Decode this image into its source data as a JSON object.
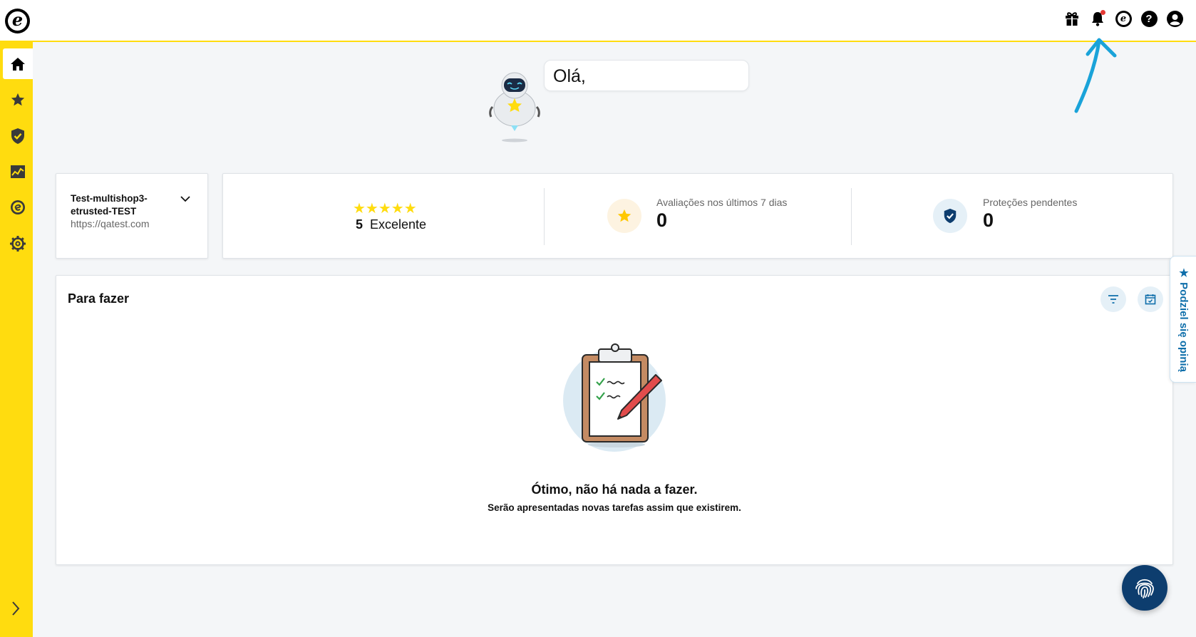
{
  "header": {
    "logo_letter": "e",
    "icons": [
      "gift-icon",
      "bell-icon",
      "trustedshops-icon",
      "help-icon",
      "account-icon"
    ],
    "trusted_letter": "e",
    "help_symbol": "?"
  },
  "sidebar": {
    "items": [
      {
        "name": "home",
        "icon": "home-icon",
        "active": true
      },
      {
        "name": "reviews",
        "icon": "star-icon",
        "active": false
      },
      {
        "name": "protection",
        "icon": "shield-icon",
        "active": false
      },
      {
        "name": "analytics",
        "icon": "chart-icon",
        "active": false
      },
      {
        "name": "etrusted",
        "icon": "e-logo-icon",
        "active": false
      },
      {
        "name": "settings",
        "icon": "gear-icon",
        "active": false
      }
    ],
    "expand_icon": "chevron-right-icon"
  },
  "greeting": {
    "text": "Olá,"
  },
  "shop": {
    "name": "Test-multishop3-etrusted-TEST",
    "url": "https://qatest.com"
  },
  "stats": {
    "stars": "★★★★★",
    "rating_value": "5",
    "rating_label": "Excelente",
    "reviews_label": "Avaliações nos últimos 7 dias",
    "reviews_value": "0",
    "protections_label": "Proteções pendentes",
    "protections_value": "0"
  },
  "todo": {
    "title": "Para fazer",
    "empty_title": "Ótimo, não há nada a fazer.",
    "empty_subtitle": "Serão apresentadas novas tarefas assim que existirem."
  },
  "feedback_tab": {
    "label": "★ Podziel się opinią"
  },
  "colors": {
    "brand_yellow": "#ffdc0f",
    "accent_blue": "#0d3d6e",
    "link_blue": "#0e6eaa",
    "arrow_blue": "#1aa3d9"
  }
}
